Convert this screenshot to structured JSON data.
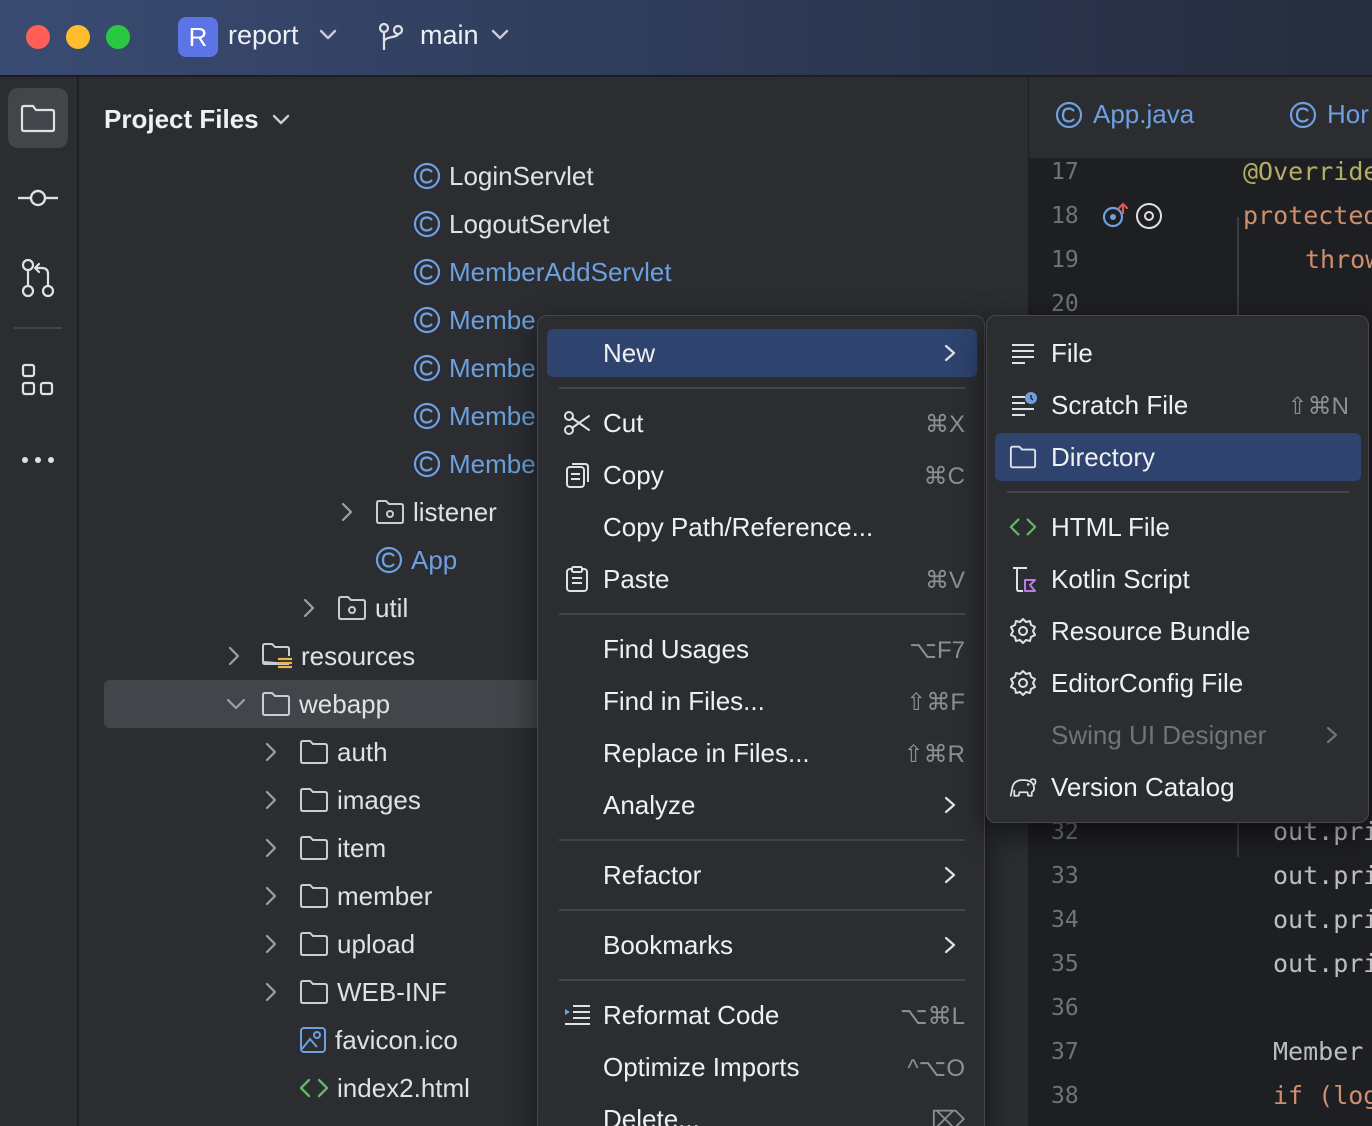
{
  "titlebar": {
    "project_initial": "R",
    "project_name": "report",
    "branch": "main"
  },
  "project_panel": {
    "title": "Project Files",
    "tree": [
      {
        "label": "LoginServlet",
        "type": "class"
      },
      {
        "label": "LogoutServlet",
        "type": "class"
      },
      {
        "label": "MemberAddServlet",
        "type": "class"
      },
      {
        "label": "Membe",
        "type": "class"
      },
      {
        "label": "Membe",
        "type": "class"
      },
      {
        "label": "Membe",
        "type": "class"
      },
      {
        "label": "Membe",
        "type": "class"
      },
      {
        "label": "listener",
        "type": "package"
      },
      {
        "label": "App",
        "type": "class"
      },
      {
        "label": "util",
        "type": "package"
      },
      {
        "label": "resources",
        "type": "resource-folder"
      },
      {
        "label": "webapp",
        "type": "folder"
      },
      {
        "label": "auth",
        "type": "folder"
      },
      {
        "label": "images",
        "type": "folder"
      },
      {
        "label": "item",
        "type": "folder"
      },
      {
        "label": "member",
        "type": "folder"
      },
      {
        "label": "upload",
        "type": "folder"
      },
      {
        "label": "WEB-INF",
        "type": "folder"
      },
      {
        "label": "favicon.ico",
        "type": "image-file"
      },
      {
        "label": "index2.html",
        "type": "html-file"
      }
    ]
  },
  "editor": {
    "tabs": [
      {
        "label": "App.java"
      },
      {
        "label": "Hor"
      }
    ],
    "gutter": [
      "17",
      "18",
      "19",
      "20",
      "32",
      "33",
      "34",
      "35",
      "36",
      "37",
      "38"
    ],
    "code": {
      "l17": "@Override",
      "l18": "protected",
      "l19": "throw",
      "l32": "out.pri",
      "l33": "out.pri",
      "l34": "out.pri",
      "l35": "out.pri",
      "l37": "Member",
      "l38": "if (log"
    }
  },
  "context_menu": {
    "items": [
      {
        "label": "New",
        "shortcut": "",
        "submenu": true
      },
      {
        "label": "Cut",
        "shortcut": "⌘X"
      },
      {
        "label": "Copy",
        "shortcut": "⌘C"
      },
      {
        "label": "Copy Path/Reference...",
        "shortcut": ""
      },
      {
        "label": "Paste",
        "shortcut": "⌘V"
      },
      {
        "label": "Find Usages",
        "shortcut": "⌥F7"
      },
      {
        "label": "Find in Files...",
        "shortcut": "⇧⌘F"
      },
      {
        "label": "Replace in Files...",
        "shortcut": "⇧⌘R"
      },
      {
        "label": "Analyze",
        "shortcut": "",
        "submenu": true
      },
      {
        "label": "Refactor",
        "shortcut": "",
        "submenu": true
      },
      {
        "label": "Bookmarks",
        "shortcut": "",
        "submenu": true
      },
      {
        "label": "Reformat Code",
        "shortcut": "⌥⌘L"
      },
      {
        "label": "Optimize Imports",
        "shortcut": "^⌥O"
      },
      {
        "label": "Delete...",
        "shortcut": "⌦"
      }
    ]
  },
  "new_submenu": {
    "items": [
      {
        "label": "File",
        "shortcut": ""
      },
      {
        "label": "Scratch File",
        "shortcut": "⇧⌘N"
      },
      {
        "label": "Directory",
        "shortcut": ""
      },
      {
        "label": "HTML File",
        "shortcut": ""
      },
      {
        "label": "Kotlin Script",
        "shortcut": ""
      },
      {
        "label": "Resource Bundle",
        "shortcut": ""
      },
      {
        "label": "EditorConfig File",
        "shortcut": ""
      },
      {
        "label": "Swing UI Designer",
        "shortcut": "",
        "disabled": true,
        "submenu": true
      },
      {
        "label": "Version Catalog",
        "shortcut": ""
      }
    ]
  },
  "colors": {
    "accent_highlight": "#2e436e",
    "class_icon": "#6e9fe0",
    "html_icon": "#5fb865",
    "kotlin_icon": "#b77ee8"
  }
}
